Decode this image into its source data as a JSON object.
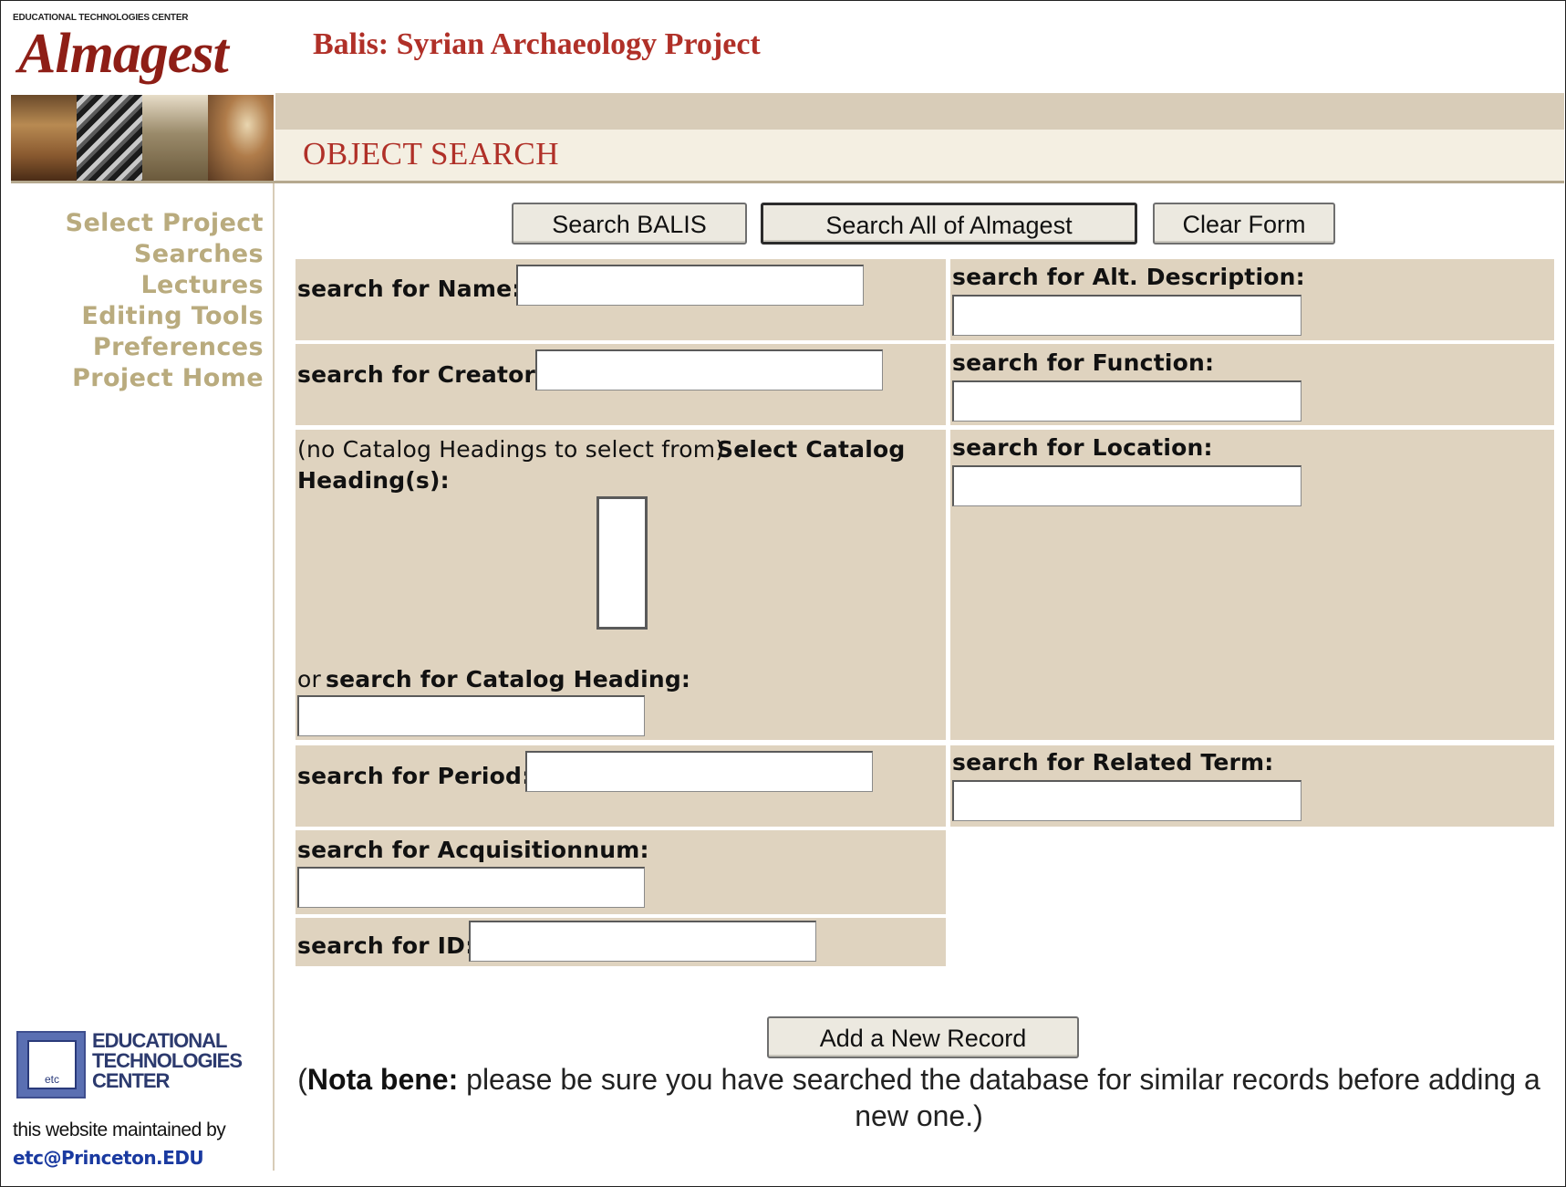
{
  "branding": {
    "org_caption": "EDUCATIONAL TECHNOLOGIES CENTER",
    "logo_word": "Almagest",
    "etc_logo_text": "etc",
    "etc_name_lines": [
      "EDUCATIONAL",
      "TECHNOLOGIES",
      "CENTER"
    ]
  },
  "header": {
    "project_title": "Balis: Syrian Archaeology Project",
    "page_title": "OBJECT SEARCH"
  },
  "sidebar": {
    "items": [
      "Select Project",
      "Searches",
      "Lectures",
      "Editing Tools",
      "Preferences",
      "Project Home"
    ],
    "maintained_by": "this website maintained by",
    "maintainer_link": "etc@Princeton.EDU"
  },
  "buttons": {
    "search_balis": "Search BALIS",
    "search_all": "Search All of Almagest",
    "clear_form": "Clear Form",
    "add_record": "Add a New Record"
  },
  "form": {
    "name_label": "search for Name:",
    "creator_label": "search for Creator:",
    "catalog_note": "(no Catalog Headings to select from)",
    "catalog_select_label_1": "Select Catalog",
    "catalog_select_label_2": "Heading(s):",
    "catalog_or": "or",
    "catalog_search_label": "search for Catalog Heading:",
    "period_label": "search for Period:",
    "acquisitionnum_label": "search for Acquisitionnum:",
    "id_label": "search for ID:",
    "alt_description_label": "search for Alt. Description:",
    "function_label": "search for Function:",
    "location_label": "search for Location:",
    "related_term_label": "search for Related Term:",
    "values": {
      "name": "",
      "creator": "",
      "catalog_heading": "",
      "period": "",
      "acquisitionnum": "",
      "id": "",
      "alt_description": "",
      "function": "",
      "location": "",
      "related_term": ""
    }
  },
  "nota_bene": {
    "label": "Nota bene:",
    "text": " please be sure you have searched the database for similar records before adding a new one.",
    "open": "(",
    "close": ")"
  },
  "colors": {
    "title_red": "#b03028",
    "panel_tan": "#dfd3bf",
    "sidebar_link": "#b9ab7e",
    "band_tan": "#d8ccb8"
  }
}
